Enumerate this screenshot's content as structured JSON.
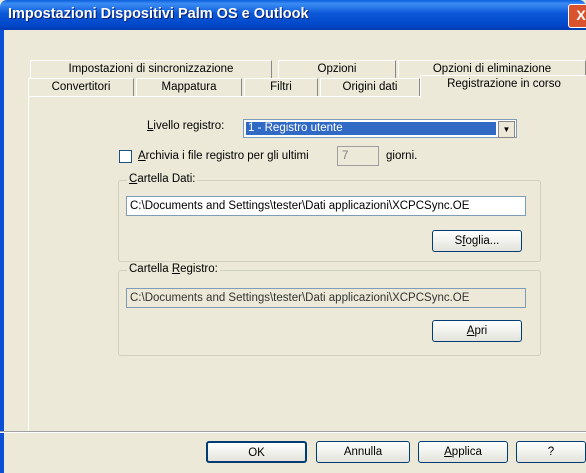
{
  "window": {
    "title": "Impostazioni Dispositivi Palm OS e Outlook",
    "close_glyph": "X"
  },
  "tabs_row1": [
    "Impostazioni di sincronizzazione",
    "Opzioni",
    "Opzioni di eliminazione"
  ],
  "tabs_row2": [
    "Convertitori",
    "Mappatura",
    "Filtri",
    "Origini dati",
    "Registrazione in corso"
  ],
  "active_tab": "Registrazione in corso",
  "log_level": {
    "label_u": "L",
    "label_rest": "ivello registro:",
    "value": "1 - Registro utente",
    "dropdown_icon": "chevron-down-icon"
  },
  "archive": {
    "checked": false,
    "label_u": "A",
    "label_rest": "rchivia i file registro per gli ultimi",
    "days": "7",
    "days_suffix": "giorni."
  },
  "data_folder": {
    "legend_u": "C",
    "legend_rest": "artella Dati:",
    "path": "C:\\Documents and Settings\\tester\\Dati applicazioni\\XCPCSync.OE",
    "browse_pre": "S",
    "browse_u": "f",
    "browse_rest": "oglia..."
  },
  "log_folder": {
    "legend_pre": "Cartella ",
    "legend_u": "R",
    "legend_rest": "egistro:",
    "path": "C:\\Documents and Settings\\tester\\Dati applicazioni\\XCPCSync.OE",
    "open_u": "A",
    "open_rest": "pri"
  },
  "buttons": {
    "ok": "OK",
    "cancel": "Annulla",
    "apply_u": "A",
    "apply_rest": "pplica",
    "help": "?"
  }
}
